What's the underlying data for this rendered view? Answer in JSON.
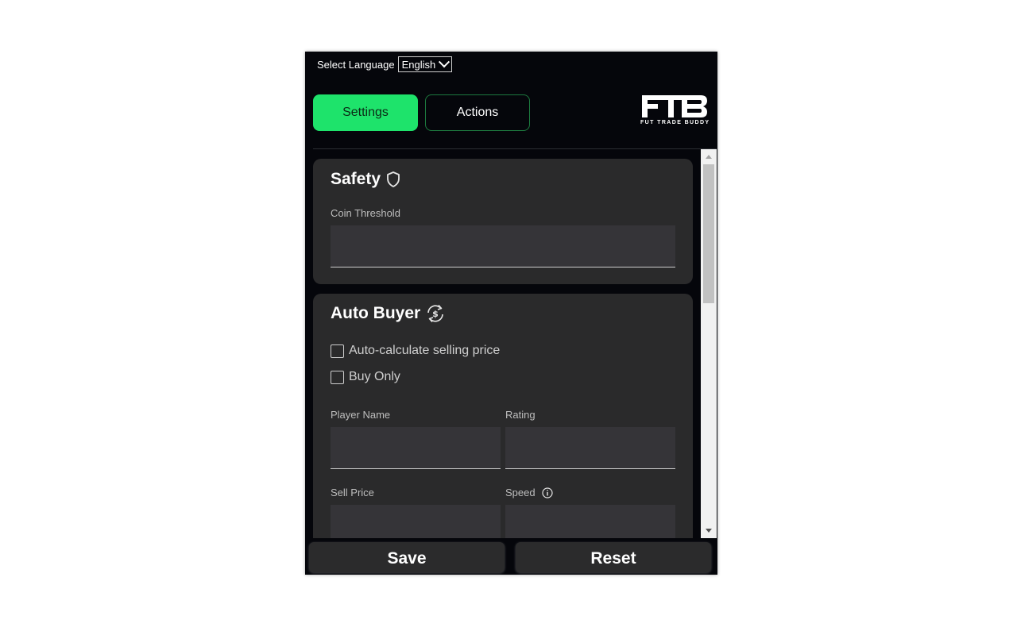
{
  "language": {
    "label": "Select Language",
    "selected": "English"
  },
  "tabs": [
    {
      "label": "Settings",
      "active": true
    },
    {
      "label": "Actions",
      "active": false
    }
  ],
  "logo": {
    "mark": "FTB",
    "subtitle": "FUT TRADE BUDDY"
  },
  "safety": {
    "title": "Safety",
    "icon": "shield-icon",
    "coin_threshold_label": "Coin Threshold",
    "coin_threshold_value": ""
  },
  "auto_buyer": {
    "title": "Auto Buyer",
    "icon": "refresh-dollar-icon",
    "checkboxes": [
      {
        "label": "Auto-calculate selling price",
        "checked": false
      },
      {
        "label": "Buy Only",
        "checked": false
      }
    ],
    "player_name_label": "Player Name",
    "rating_label": "Rating",
    "sell_price_label": "Sell Price",
    "speed_label": "Speed",
    "speed_icon": "info-icon"
  },
  "buttons": {
    "save": "Save",
    "reset": "Reset"
  },
  "colors": {
    "accent": "#1ee36b",
    "background": "#05060b",
    "card": "#2a2a2b",
    "input": "#353438"
  }
}
